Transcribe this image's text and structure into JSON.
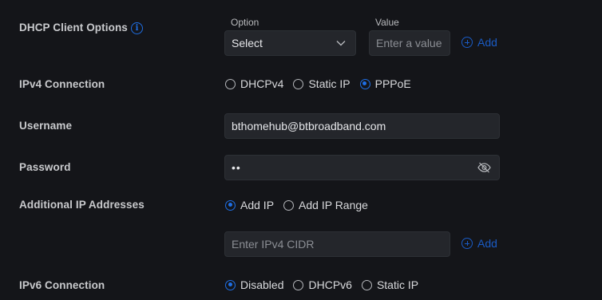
{
  "dhcp_client_options": {
    "label": "DHCP Client Options",
    "option_label": "Option",
    "value_label": "Value",
    "select_value": "Select",
    "value_placeholder": "Enter a value",
    "add_label": "Add"
  },
  "ipv4_connection": {
    "label": "IPv4 Connection",
    "options": [
      "DHCPv4",
      "Static IP",
      "PPPoE"
    ],
    "selected": "PPPoE"
  },
  "username": {
    "label": "Username",
    "value": "bthomehub@btbroadband.com"
  },
  "password": {
    "label": "Password",
    "masked_value": "••"
  },
  "additional_ip": {
    "label": "Additional IP Addresses",
    "options": [
      "Add IP",
      "Add IP Range"
    ],
    "selected": "Add IP",
    "cidr_placeholder": "Enter IPv4 CIDR",
    "add_label": "Add"
  },
  "ipv6_connection": {
    "label": "IPv6 Connection",
    "options": [
      "Disabled",
      "DHCPv6",
      "Static IP"
    ],
    "selected": "Disabled"
  },
  "colors": {
    "accent": "#1f6fe5",
    "background": "#141519",
    "field": "#24262b"
  }
}
